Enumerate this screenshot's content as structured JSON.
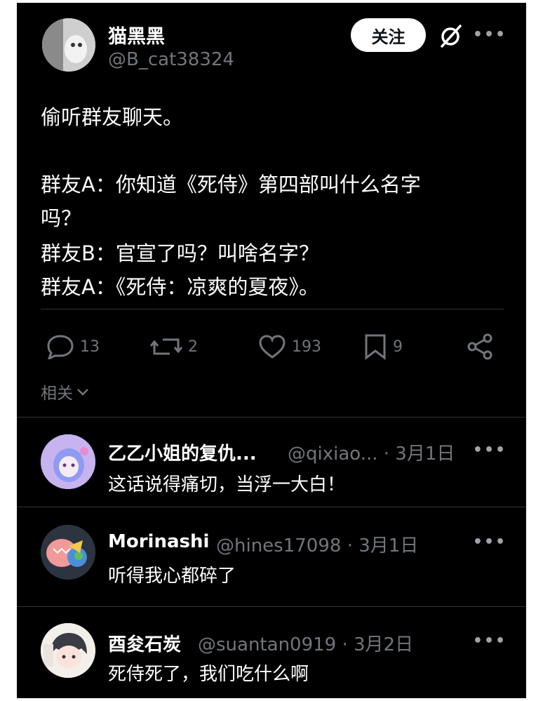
{
  "author": {
    "name": "猫黑黑",
    "handle": "@B_cat38324",
    "follow_label": "关注"
  },
  "post": {
    "lines": [
      "偷听群友聊天。",
      "群友A：你知道《死侍》第四部叫什么名字",
      "吗？",
      "群友B：官宣了吗？叫啥名字？",
      "群友A：《死侍：凉爽的夏夜》。"
    ]
  },
  "actions": {
    "replies": "13",
    "reposts": "2",
    "likes": "193",
    "bookmarks": "9"
  },
  "related_label": "相关",
  "replies": [
    {
      "name": "乙乙小姐的复仇...",
      "meta": "@qixiao... · 3月1日",
      "text": "这话说得痛切，当浮一大白！"
    },
    {
      "name": "Morinashi",
      "meta": "@hines17098 · 3月1日",
      "text": "听得我心都碎了"
    },
    {
      "name": "酉夋石炭",
      "meta": "@suantan0919 · 3月2日",
      "text": "死侍死了，我们吃什么啊"
    }
  ],
  "colors": {
    "background": "#000000",
    "text": "#ffffff",
    "muted": "#71767b",
    "divider": "#2f3336"
  }
}
